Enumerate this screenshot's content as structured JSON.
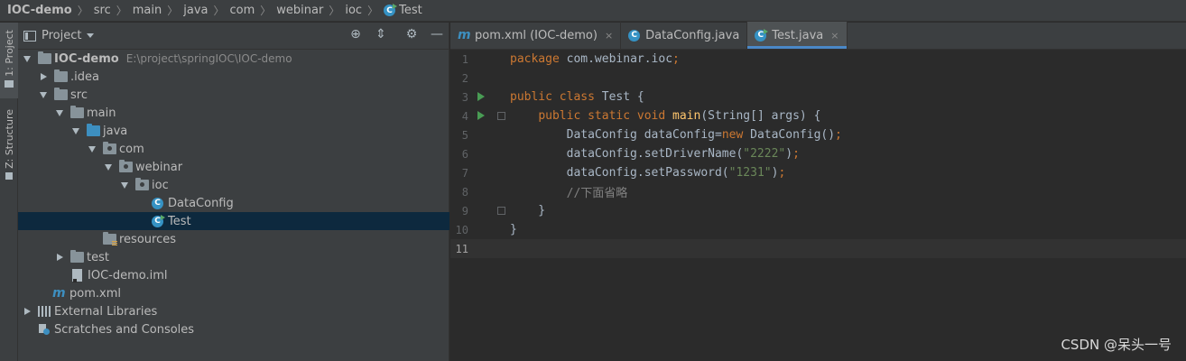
{
  "breadcrumb": {
    "items": [
      "IOC-demo",
      "src",
      "main",
      "java",
      "com",
      "webinar",
      "ioc",
      "Test"
    ]
  },
  "left_strip": {
    "tab_project": "1: Project",
    "tab_structure": "Z: Structure"
  },
  "project_panel": {
    "title": "Project",
    "tree": [
      {
        "label": "IOC-demo",
        "path": "E:\\project\\springIOC\\IOC-demo"
      },
      {
        "label": ".idea"
      },
      {
        "label": "src"
      },
      {
        "label": "main"
      },
      {
        "label": "java"
      },
      {
        "label": "com"
      },
      {
        "label": "webinar"
      },
      {
        "label": "ioc"
      },
      {
        "label": "DataConfig"
      },
      {
        "label": "Test"
      },
      {
        "label": "resources"
      },
      {
        "label": "test"
      },
      {
        "label": "IOC-demo.iml"
      },
      {
        "label": "pom.xml"
      },
      {
        "label": "External Libraries"
      },
      {
        "label": "Scratches and Consoles"
      }
    ]
  },
  "editor": {
    "tabs": [
      {
        "label": "pom.xml (IOC-demo)",
        "icon": "maven-icon"
      },
      {
        "label": "DataConfig.java",
        "icon": "class-icon"
      },
      {
        "label": "Test.java",
        "icon": "class-run-icon",
        "active": true
      }
    ],
    "close_glyph": "×",
    "lines": [
      {
        "num": "1",
        "tokens": [
          [
            "kw",
            "package "
          ],
          [
            "pl",
            "com.webinar.ioc"
          ],
          [
            "kw",
            ";"
          ]
        ]
      },
      {
        "num": "2",
        "tokens": []
      },
      {
        "num": "3",
        "run": true,
        "tokens": [
          [
            "kw",
            "public class "
          ],
          [
            "pl",
            "Test {"
          ]
        ]
      },
      {
        "num": "4",
        "run": true,
        "fold": true,
        "tokens": [
          [
            "pl",
            "    "
          ],
          [
            "kw",
            "public static void "
          ],
          [
            "fn",
            "main"
          ],
          [
            "pl",
            "(String[] args) {"
          ]
        ]
      },
      {
        "num": "5",
        "tokens": [
          [
            "pl",
            "        DataConfig dataConfig="
          ],
          [
            "kw",
            "new "
          ],
          [
            "pl",
            "DataConfig()"
          ],
          [
            "kw",
            ";"
          ]
        ]
      },
      {
        "num": "6",
        "tokens": [
          [
            "pl",
            "        dataConfig.setDriverName("
          ],
          [
            "str",
            "\"2222\""
          ],
          [
            "pl",
            ")"
          ],
          [
            "kw",
            ";"
          ]
        ]
      },
      {
        "num": "7",
        "tokens": [
          [
            "pl",
            "        dataConfig.setPassword("
          ],
          [
            "str",
            "\"1231\""
          ],
          [
            "pl",
            ")"
          ],
          [
            "kw",
            ";"
          ]
        ]
      },
      {
        "num": "8",
        "tokens": [
          [
            "cm",
            "        //下面省略"
          ]
        ]
      },
      {
        "num": "9",
        "fold": true,
        "tokens": [
          [
            "pl",
            "    }"
          ]
        ]
      },
      {
        "num": "10",
        "tokens": [
          [
            "pl",
            "}"
          ]
        ]
      },
      {
        "num": "11",
        "current": true,
        "tokens": []
      }
    ]
  },
  "watermark": "CSDN @呆头一号"
}
